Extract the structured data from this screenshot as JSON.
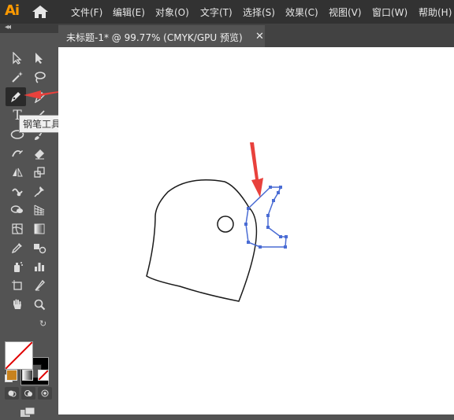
{
  "app": {
    "logo": "Ai"
  },
  "menus": [
    "文件(F)",
    "编辑(E)",
    "对象(O)",
    "文字(T)",
    "选择(S)",
    "效果(C)",
    "视图(V)",
    "窗口(W)",
    "帮助(H)"
  ],
  "document_tab": {
    "title": "未标题-1* @ 99.77% (CMYK/GPU 预览)",
    "close": "✕"
  },
  "toolbar": {
    "collapse": "◂◂",
    "tools": [
      "selection-tool",
      "direct-selection-tool",
      "magic-wand-tool",
      "lasso-tool",
      "pen-tool",
      "curvature-tool",
      "type-tool",
      "line-segment-tool",
      "ellipse-tool",
      "paintbrush-tool",
      "shaper-tool",
      "eraser-tool",
      "reflect-tool",
      "scale-tool",
      "warp-tool",
      "puppet-warp-tool",
      "shape-builder-tool",
      "perspective-grid-tool",
      "mesh-tool",
      "gradient-tool",
      "eyedropper-tool",
      "blend-tool",
      "symbol-sprayer-tool",
      "column-graph-tool",
      "artboard-tool",
      "slice-tool",
      "hand-tool",
      "zoom-tool"
    ],
    "type_glyph": "T"
  },
  "tooltip": {
    "text": "钢笔工具 (P)"
  },
  "colors": {
    "accent_arrow": "#e8413c",
    "path_selected": "#4a6cd4",
    "fill_swatch": "#ffffff",
    "stroke_swatch": "#000000",
    "none_slash": "#e00000"
  }
}
